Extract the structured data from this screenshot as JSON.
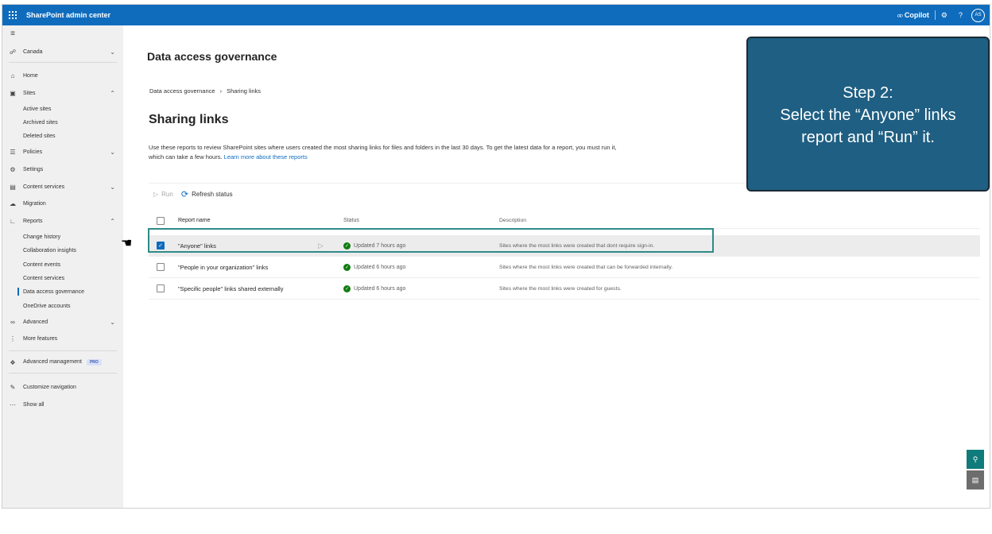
{
  "topbar": {
    "app_title": "SharePoint admin center",
    "copilot_label": "Copilot",
    "avatar_initials": "AS"
  },
  "sidebar": {
    "items": [
      {
        "label": "Canada",
        "icon": "globe-icon",
        "chevron": "down"
      },
      {
        "label": "Home",
        "icon": "home-icon"
      },
      {
        "label": "Sites",
        "icon": "sites-icon",
        "chevron": "up"
      },
      {
        "label": "Active sites",
        "sub": true
      },
      {
        "label": "Archived sites",
        "sub": true
      },
      {
        "label": "Deleted sites",
        "sub": true
      },
      {
        "label": "Policies",
        "icon": "policies-icon",
        "chevron": "down"
      },
      {
        "label": "Settings",
        "icon": "gear-icon"
      },
      {
        "label": "Content services",
        "icon": "content-services-icon",
        "chevron": "down"
      },
      {
        "label": "Migration",
        "icon": "migration-icon"
      },
      {
        "label": "Reports",
        "icon": "reports-icon",
        "chevron": "up"
      },
      {
        "label": "Change history",
        "sub": true
      },
      {
        "label": "Collaboration insights",
        "sub": true
      },
      {
        "label": "Content events",
        "sub": true
      },
      {
        "label": "Content services",
        "sub": true
      },
      {
        "label": "Data access governance",
        "sub": true,
        "active": true
      },
      {
        "label": "OneDrive accounts",
        "sub": true
      },
      {
        "label": "Advanced",
        "icon": "advanced-icon",
        "chevron": "down"
      },
      {
        "label": "More features",
        "icon": "more-features-icon"
      },
      {
        "label": "Advanced management",
        "icon": "diamond-icon",
        "badge": "PRO"
      },
      {
        "label": "Customize navigation",
        "icon": "pencil-icon"
      },
      {
        "label": "Show all",
        "icon": "ellipsis-icon"
      }
    ]
  },
  "main": {
    "heading": "Data access governance",
    "breadcrumb": [
      "Data access governance",
      "Sharing links"
    ],
    "title": "Sharing links",
    "description": "Use these reports to review SharePoint sites where users created the most sharing links for files and folders in the last 30 days. To get the latest data for a report, you must run it, which can take a few hours.",
    "learn_more": "Learn more about these reports",
    "toolbar": {
      "run": "Run",
      "refresh": "Refresh status"
    },
    "table": {
      "headers": {
        "name": "Report name",
        "status": "Status",
        "description": "Description"
      },
      "rows": [
        {
          "name": "\"Anyone\" links",
          "status": "Updated 7 hours ago",
          "description": "Sites where the most links were created that dont require sign-in.",
          "selected": true
        },
        {
          "name": "\"People in your organization\" links",
          "status": "Updated 6 hours ago",
          "description": "Sites where the most links were created that can be forwarded internally.",
          "selected": false
        },
        {
          "name": "\"Specific people\" links shared externally",
          "status": "Updated 6 hours ago",
          "description": "Sites where the most links were created for guests.",
          "selected": false
        }
      ]
    }
  },
  "callout": {
    "line1": "Step 2:",
    "line2": "Select the “Anyone” links",
    "line3": "report and “Run” it."
  },
  "colors": {
    "brand": "#0f6cbd",
    "callout": "#1f5f83",
    "highlight": "#2e8b86",
    "success": "#107c10"
  }
}
